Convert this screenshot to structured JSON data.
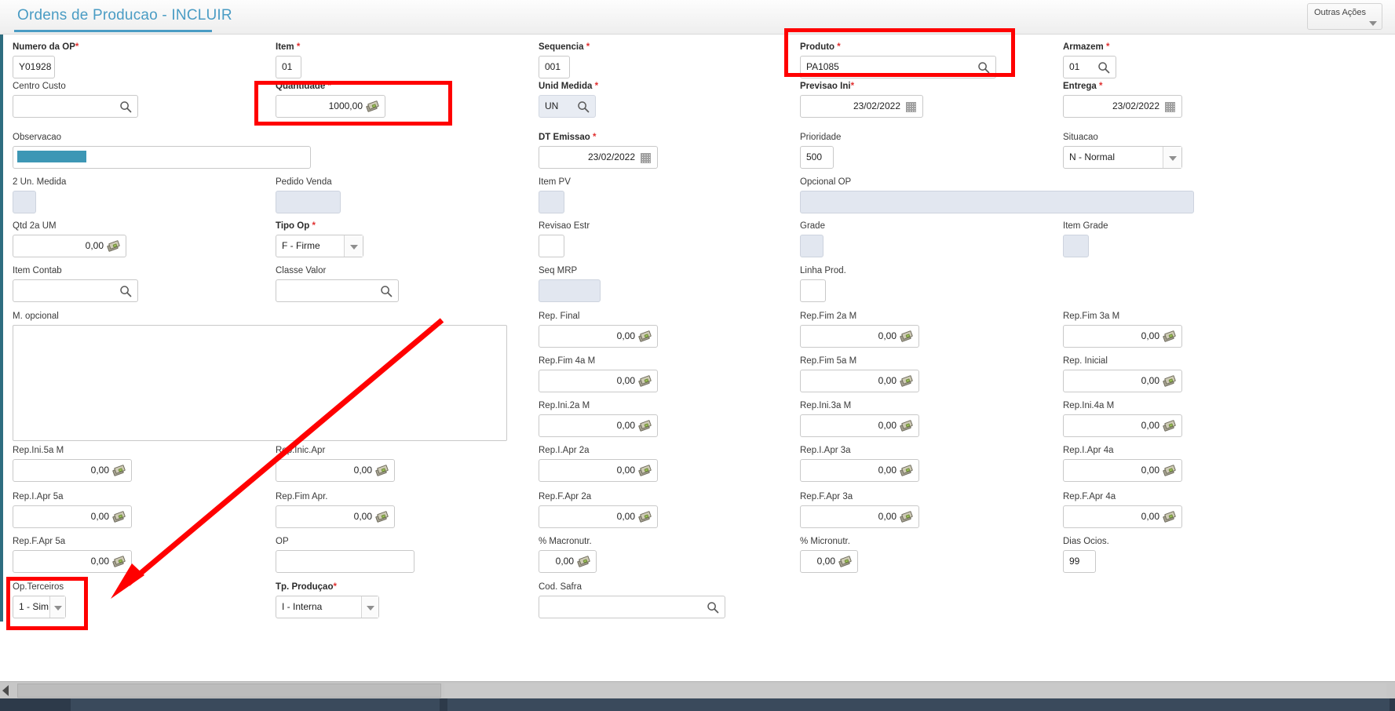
{
  "window": {
    "title": "Ordens de Producao - INCLUIR",
    "accent_color": "#4a9cc4",
    "annotation_color": "#ff0000"
  },
  "toolbar": {
    "other_actions_label": "Outras Ações",
    "caret_icon": "chevron-down-icon"
  },
  "fields": {
    "numero_op": {
      "label": "Numero da OP",
      "required": true,
      "value": "Y01928"
    },
    "item": {
      "label": "Item",
      "required": true,
      "value": "01"
    },
    "sequencia": {
      "label": "Sequencia",
      "required": true,
      "value": "001"
    },
    "produto": {
      "label": "Produto",
      "required": true,
      "value": "PA1085",
      "icon": "search-icon"
    },
    "armazem": {
      "label": "Armazem",
      "required": true,
      "value": "01",
      "icon": "search-icon"
    },
    "centro_custo": {
      "label": "Centro Custo",
      "required": false,
      "value": "",
      "icon": "search-icon"
    },
    "quantidade": {
      "label": "Quantidade",
      "required": true,
      "value": "1000,00",
      "icon": "money-icon"
    },
    "unid_medida": {
      "label": "Unid Medida",
      "required": true,
      "value": "UN",
      "icon": "search-icon"
    },
    "previsao_ini": {
      "label": "Previsao Ini",
      "required": true,
      "value": "23/02/2022",
      "icon": "calendar-icon"
    },
    "entrega": {
      "label": "Entrega",
      "required": true,
      "value": "23/02/2022",
      "icon": "calendar-icon"
    },
    "observacao": {
      "label": "Observacao",
      "required": false,
      "value": ""
    },
    "dt_emissao": {
      "label": "DT Emissao",
      "required": true,
      "value": "23/02/2022",
      "icon": "calendar-icon"
    },
    "prioridade": {
      "label": "Prioridade",
      "required": false,
      "value": "500"
    },
    "situacao": {
      "label": "Situacao",
      "required": false,
      "value": "N - Normal",
      "icon": "chevron-down-icon"
    },
    "un_medida_2": {
      "label": "2 Un. Medida",
      "required": false,
      "value": ""
    },
    "pedido_venda": {
      "label": "Pedido Venda",
      "required": false,
      "value": ""
    },
    "item_pv": {
      "label": "Item PV",
      "required": false,
      "value": ""
    },
    "opcional_op": {
      "label": "Opcional OP",
      "required": false,
      "value": ""
    },
    "qtd_2a_um": {
      "label": "Qtd 2a UM",
      "required": false,
      "value": "0,00",
      "icon": "money-icon"
    },
    "tipo_op": {
      "label": "Tipo Op",
      "required": true,
      "value": "F - Firme",
      "icon": "chevron-down-icon"
    },
    "revisao_estr": {
      "label": "Revisao Estr",
      "required": false,
      "value": ""
    },
    "grade": {
      "label": "Grade",
      "required": false,
      "value": ""
    },
    "item_grade": {
      "label": "Item Grade",
      "required": false,
      "value": ""
    },
    "item_contab": {
      "label": "Item Contab",
      "required": false,
      "value": "",
      "icon": "search-icon"
    },
    "classe_valor": {
      "label": "Classe Valor",
      "required": false,
      "value": "",
      "icon": "search-icon"
    },
    "seq_mrp": {
      "label": "Seq MRP",
      "required": false,
      "value": ""
    },
    "linha_prod": {
      "label": "Linha Prod.",
      "required": false,
      "value": ""
    },
    "m_opcional": {
      "label": "M. opcional",
      "required": false,
      "value": ""
    },
    "rep_final": {
      "label": "Rep. Final",
      "required": false,
      "value": "0,00",
      "icon": "money-icon"
    },
    "rep_fim_2a_m": {
      "label": "Rep.Fim 2a M",
      "required": false,
      "value": "0,00",
      "icon": "money-icon"
    },
    "rep_fim_3a_m": {
      "label": "Rep.Fim 3a M",
      "required": false,
      "value": "0,00",
      "icon": "money-icon"
    },
    "rep_fim_4a_m": {
      "label": "Rep.Fim 4a M",
      "required": false,
      "value": "0,00",
      "icon": "money-icon"
    },
    "rep_fim_5a_m": {
      "label": "Rep.Fim 5a M",
      "required": false,
      "value": "0,00",
      "icon": "money-icon"
    },
    "rep_inicial": {
      "label": "Rep. Inicial",
      "required": false,
      "value": "0,00",
      "icon": "money-icon"
    },
    "rep_ini_2a_m": {
      "label": "Rep.Ini.2a M",
      "required": false,
      "value": "0,00",
      "icon": "money-icon"
    },
    "rep_ini_3a_m": {
      "label": "Rep.Ini.3a M",
      "required": false,
      "value": "0,00",
      "icon": "money-icon"
    },
    "rep_ini_4a_m": {
      "label": "Rep.Ini.4a M",
      "required": false,
      "value": "0,00",
      "icon": "money-icon"
    },
    "rep_ini_5a_m": {
      "label": "Rep.Ini.5a M",
      "required": false,
      "value": "0,00",
      "icon": "money-icon"
    },
    "rep_inic_apr": {
      "label": "Rep.Inic.Apr",
      "required": false,
      "value": "0,00",
      "icon": "money-icon"
    },
    "rep_i_apr_2a": {
      "label": "Rep.I.Apr 2a",
      "required": false,
      "value": "0,00",
      "icon": "money-icon"
    },
    "rep_i_apr_3a": {
      "label": "Rep.I.Apr 3a",
      "required": false,
      "value": "0,00",
      "icon": "money-icon"
    },
    "rep_i_apr_4a": {
      "label": "Rep.I.Apr 4a",
      "required": false,
      "value": "0,00",
      "icon": "money-icon"
    },
    "rep_i_apr_5a": {
      "label": "Rep.I.Apr 5a",
      "required": false,
      "value": "0,00",
      "icon": "money-icon"
    },
    "rep_fim_apr": {
      "label": "Rep.Fim Apr.",
      "required": false,
      "value": "0,00",
      "icon": "money-icon"
    },
    "rep_f_apr_2a": {
      "label": "Rep.F.Apr 2a",
      "required": false,
      "value": "0,00",
      "icon": "money-icon"
    },
    "rep_f_apr_3a": {
      "label": "Rep.F.Apr 3a",
      "required": false,
      "value": "0,00",
      "icon": "money-icon"
    },
    "rep_f_apr_4a": {
      "label": "Rep.F.Apr 4a",
      "required": false,
      "value": "0,00",
      "icon": "money-icon"
    },
    "rep_f_apr_5a": {
      "label": "Rep.F.Apr 5a",
      "required": false,
      "value": "0,00",
      "icon": "money-icon"
    },
    "op": {
      "label": "OP",
      "required": false,
      "value": ""
    },
    "pct_macronutr": {
      "label": "% Macronutr.",
      "required": false,
      "value": "0,00",
      "icon": "money-icon"
    },
    "pct_micronutr": {
      "label": "% Micronutr.",
      "required": false,
      "value": "0,00",
      "icon": "money-icon"
    },
    "dias_ocios": {
      "label": "Dias Ocios.",
      "required": false,
      "value": "99"
    },
    "op_terceiros": {
      "label": "Op.Terceiros",
      "required": false,
      "value": "1 - Sim",
      "icon": "chevron-down-icon"
    },
    "tp_producao": {
      "label": "Tp. Produçao",
      "required": true,
      "value": "I - Interna",
      "icon": "chevron-down-icon"
    },
    "cod_safra": {
      "label": "Cod. Safra",
      "required": false,
      "value": "",
      "icon": "search-icon"
    }
  },
  "annotations": {
    "highlight_quantidade": "red-rectangle",
    "highlight_produto": "red-rectangle",
    "highlight_op_terceiros": "red-rectangle",
    "arrow_to_op_terceiros": "red-arrow"
  }
}
